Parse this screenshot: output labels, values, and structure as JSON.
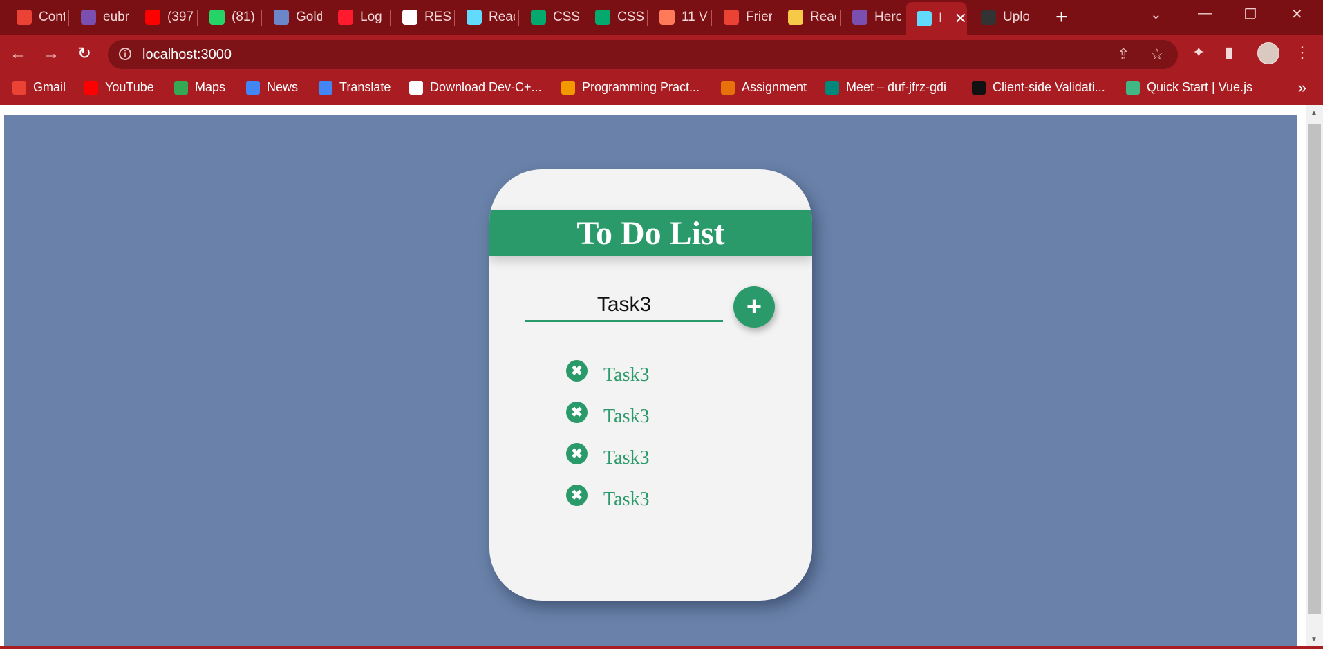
{
  "browser": {
    "tabs": [
      {
        "title": "Cont",
        "icon": "gmail-icon",
        "color": "#ea4335"
      },
      {
        "title": "eubr",
        "icon": "heroku-icon",
        "color": "#7a4fb0"
      },
      {
        "title": "(397",
        "icon": "youtube-icon",
        "color": "#ff0000"
      },
      {
        "title": "(81)",
        "icon": "whatsapp-icon",
        "color": "#25d366"
      },
      {
        "title": "Gold",
        "icon": "page-icon",
        "color": "#6b86c9"
      },
      {
        "title": "Log",
        "icon": "opera-icon",
        "color": "#ff1b2d"
      },
      {
        "title": "RESU",
        "icon": "globe-icon",
        "color": "#ffffff"
      },
      {
        "title": "Reac",
        "icon": "react-icon",
        "color": "#61dafb"
      },
      {
        "title": "CSS",
        "icon": "w3schools-icon",
        "color": "#04aa6d"
      },
      {
        "title": "CSS",
        "icon": "w3schools-icon",
        "color": "#04aa6d"
      },
      {
        "title": "11 V",
        "icon": "hubspot-icon",
        "color": "#ff7a59"
      },
      {
        "title": "Frier",
        "icon": "gmail-icon",
        "color": "#ea4335"
      },
      {
        "title": "Reac",
        "icon": "emoji-icon",
        "color": "#f7c948"
      },
      {
        "title": "Hero",
        "icon": "heroku-icon",
        "color": "#7a4fb0"
      },
      {
        "title": "I",
        "icon": "react-icon",
        "color": "#61dafb"
      },
      {
        "title": "Uplo",
        "icon": "github-icon",
        "color": "#333333"
      }
    ],
    "new_tab_symbol": "+",
    "address": "localhost:3000",
    "bookmarks": [
      {
        "label": "Gmail",
        "icon": "gmail-icon",
        "color": "#ea4335"
      },
      {
        "label": "YouTube",
        "icon": "youtube-icon",
        "color": "#ff0000"
      },
      {
        "label": "Maps",
        "icon": "maps-icon",
        "color": "#34a853"
      },
      {
        "label": "News",
        "icon": "news-icon",
        "color": "#4285f4"
      },
      {
        "label": "Translate",
        "icon": "translate-icon",
        "color": "#4285f4"
      },
      {
        "label": "Download Dev-C+...",
        "icon": "globe-icon",
        "color": "#ffffff"
      },
      {
        "label": "Programming Pract...",
        "icon": "person-icon",
        "color": "#f29900"
      },
      {
        "label": "Assignment",
        "icon": "m-icon",
        "color": "#e8710a"
      },
      {
        "label": "Meet – duf-jfrz-gdi",
        "icon": "meet-icon",
        "color": "#00897b"
      },
      {
        "label": "Client-side Validati...",
        "icon": "cwr-icon",
        "color": "#111111"
      },
      {
        "label": "Quick Start | Vue.js",
        "icon": "vue-icon",
        "color": "#41b883"
      }
    ],
    "bookmarks_more": "»"
  },
  "app": {
    "title": "To Do List",
    "input_value": "Task3",
    "add_symbol": "+",
    "delete_symbol": "✖",
    "accent": "#2b9a6a",
    "background": "#6a82a9",
    "tasks": [
      "Task3",
      "Task3",
      "Task3",
      "Task3"
    ]
  }
}
